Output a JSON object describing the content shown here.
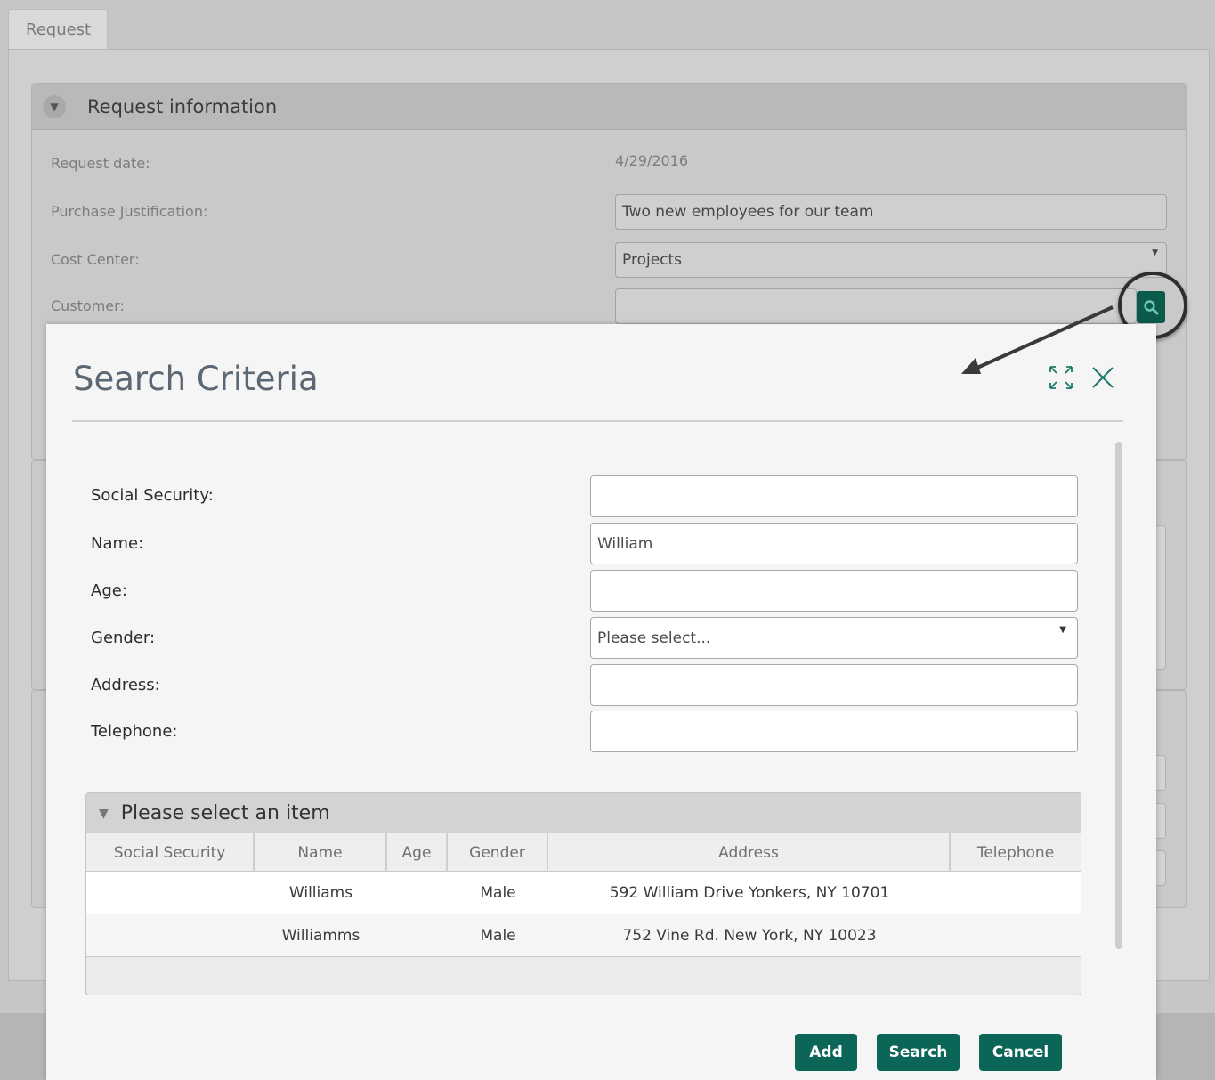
{
  "tab": {
    "label": "Request"
  },
  "request_info": {
    "title": "Request information",
    "fields": {
      "request_date": {
        "label": "Request date:",
        "value": "4/29/2016"
      },
      "justification": {
        "label": "Purchase Justification:",
        "value": "Two new employees for our team"
      },
      "cost_center": {
        "label": "Cost Center:",
        "value": "Projects"
      },
      "customer": {
        "label": "Customer:",
        "value": ""
      }
    }
  },
  "modal": {
    "title": "Search Criteria",
    "fields": {
      "social_security": {
        "label": "Social Security:",
        "value": ""
      },
      "name": {
        "label": "Name:",
        "value": "William"
      },
      "age": {
        "label": "Age:",
        "value": ""
      },
      "gender": {
        "label": "Gender:",
        "value": "Please select..."
      },
      "address": {
        "label": "Address:",
        "value": ""
      },
      "telephone": {
        "label": "Telephone:",
        "value": ""
      }
    },
    "results": {
      "title": "Please select an item",
      "columns": [
        "Social Security",
        "Name",
        "Age",
        "Gender",
        "Address",
        "Telephone"
      ],
      "rows": [
        {
          "social_security": "",
          "name": "Williams",
          "age": "",
          "gender": "Male",
          "address": "592 William Drive Yonkers, NY 10701",
          "telephone": ""
        },
        {
          "social_security": "",
          "name": "Williamms",
          "age": "",
          "gender": "Male",
          "address": "752 Vine Rd. New York, NY 10023",
          "telephone": ""
        }
      ]
    },
    "buttons": {
      "add": "Add",
      "search": "Search",
      "cancel": "Cancel"
    }
  },
  "colors": {
    "accent": "#0b6657",
    "title": "#5b6773"
  },
  "icons": [
    "chevron-down-icon",
    "search-icon",
    "expand-icon",
    "close-icon",
    "annotation-arrow"
  ]
}
